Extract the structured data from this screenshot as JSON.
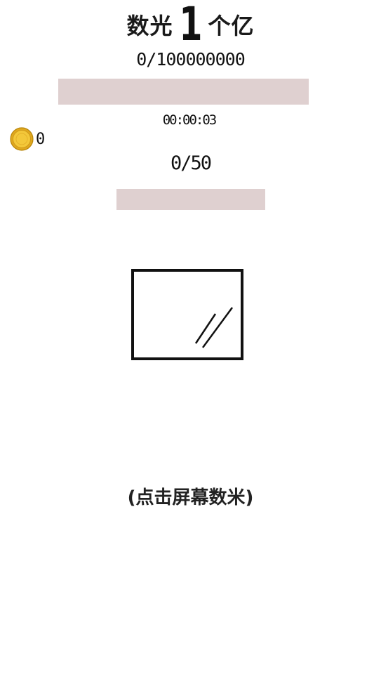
{
  "title": {
    "prefix": "数光",
    "big_number": "1",
    "suffix": "个亿"
  },
  "total_progress": {
    "text": "0/100000000",
    "current": 0,
    "target": 100000000,
    "fraction": 0
  },
  "timer": {
    "text": "00:00:03"
  },
  "coins": {
    "icon": "coin-icon",
    "count": "0"
  },
  "level_progress": {
    "text": "0/50",
    "current": 0,
    "target": 50,
    "fraction": 0
  },
  "window_icon": "window-frame-icon",
  "hint": {
    "text": "(点击屏幕数米)"
  },
  "colors": {
    "bar_track": "#dfd0d0",
    "coin": "#f3c83a",
    "text": "#111111"
  }
}
